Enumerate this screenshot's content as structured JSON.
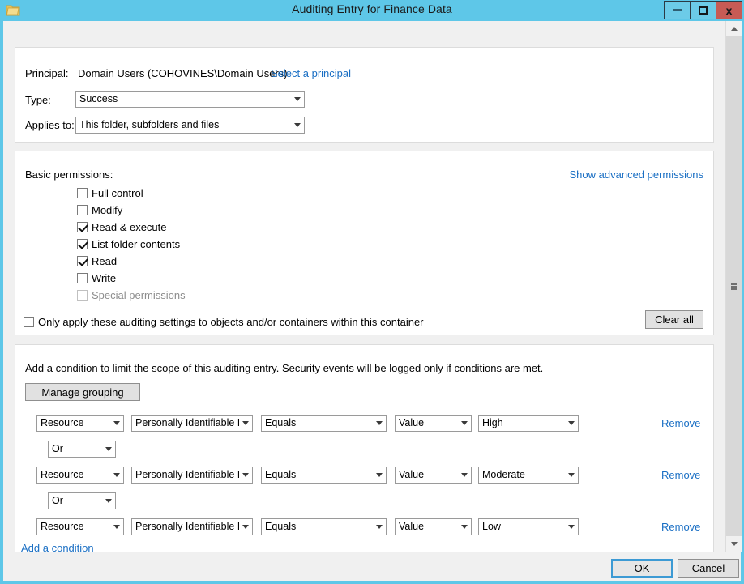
{
  "window": {
    "title": "Auditing Entry for Finance Data",
    "icon": "folder-icon",
    "minimize_label": "–",
    "maximize_label": "□",
    "close_label": "x",
    "accent_color": "#5ec7e8",
    "close_color": "#c75b55"
  },
  "principal": {
    "principal_label": "Principal:",
    "principal_value": "Domain Users (COHOVINES\\Domain Users)",
    "select_principal_link": "Select a principal",
    "type_label": "Type:",
    "type_value": "Success",
    "applies_to_label": "Applies to:",
    "applies_to_value": "This folder, subfolders and files"
  },
  "permissions": {
    "heading": "Basic permissions:",
    "advanced_link": "Show advanced permissions",
    "items": [
      {
        "label": "Full control",
        "checked": false,
        "disabled": false
      },
      {
        "label": "Modify",
        "checked": false,
        "disabled": false
      },
      {
        "label": "Read & execute",
        "checked": true,
        "disabled": false
      },
      {
        "label": "List folder contents",
        "checked": true,
        "disabled": false
      },
      {
        "label": "Read",
        "checked": true,
        "disabled": false
      },
      {
        "label": "Write",
        "checked": false,
        "disabled": false
      },
      {
        "label": "Special permissions",
        "checked": false,
        "disabled": true
      }
    ],
    "only_apply_label": "Only apply these auditing settings to objects and/or containers within this container",
    "only_apply_checked": false,
    "clear_all_label": "Clear all"
  },
  "conditions": {
    "description": "Add a condition to limit the scope of this auditing entry. Security events will be logged only if conditions are met.",
    "manage_grouping_label": "Manage grouping",
    "add_condition_link": "Add a condition",
    "remove_link": "Remove",
    "rows": [
      {
        "entity": "Resource",
        "attribute": "Personally Identifiable Ir",
        "operator": "Equals",
        "source": "Value",
        "value": "High",
        "remove": "Remove"
      },
      {
        "entity": "Resource",
        "attribute": "Personally Identifiable Ir",
        "operator": "Equals",
        "source": "Value",
        "value": "Moderate",
        "remove": "Remove"
      },
      {
        "entity": "Resource",
        "attribute": "Personally Identifiable Ir",
        "operator": "Equals",
        "source": "Value",
        "value": "Low",
        "remove": "Remove"
      }
    ],
    "joins": [
      "Or",
      "Or"
    ]
  },
  "footer": {
    "ok_label": "OK",
    "cancel_label": "Cancel"
  }
}
